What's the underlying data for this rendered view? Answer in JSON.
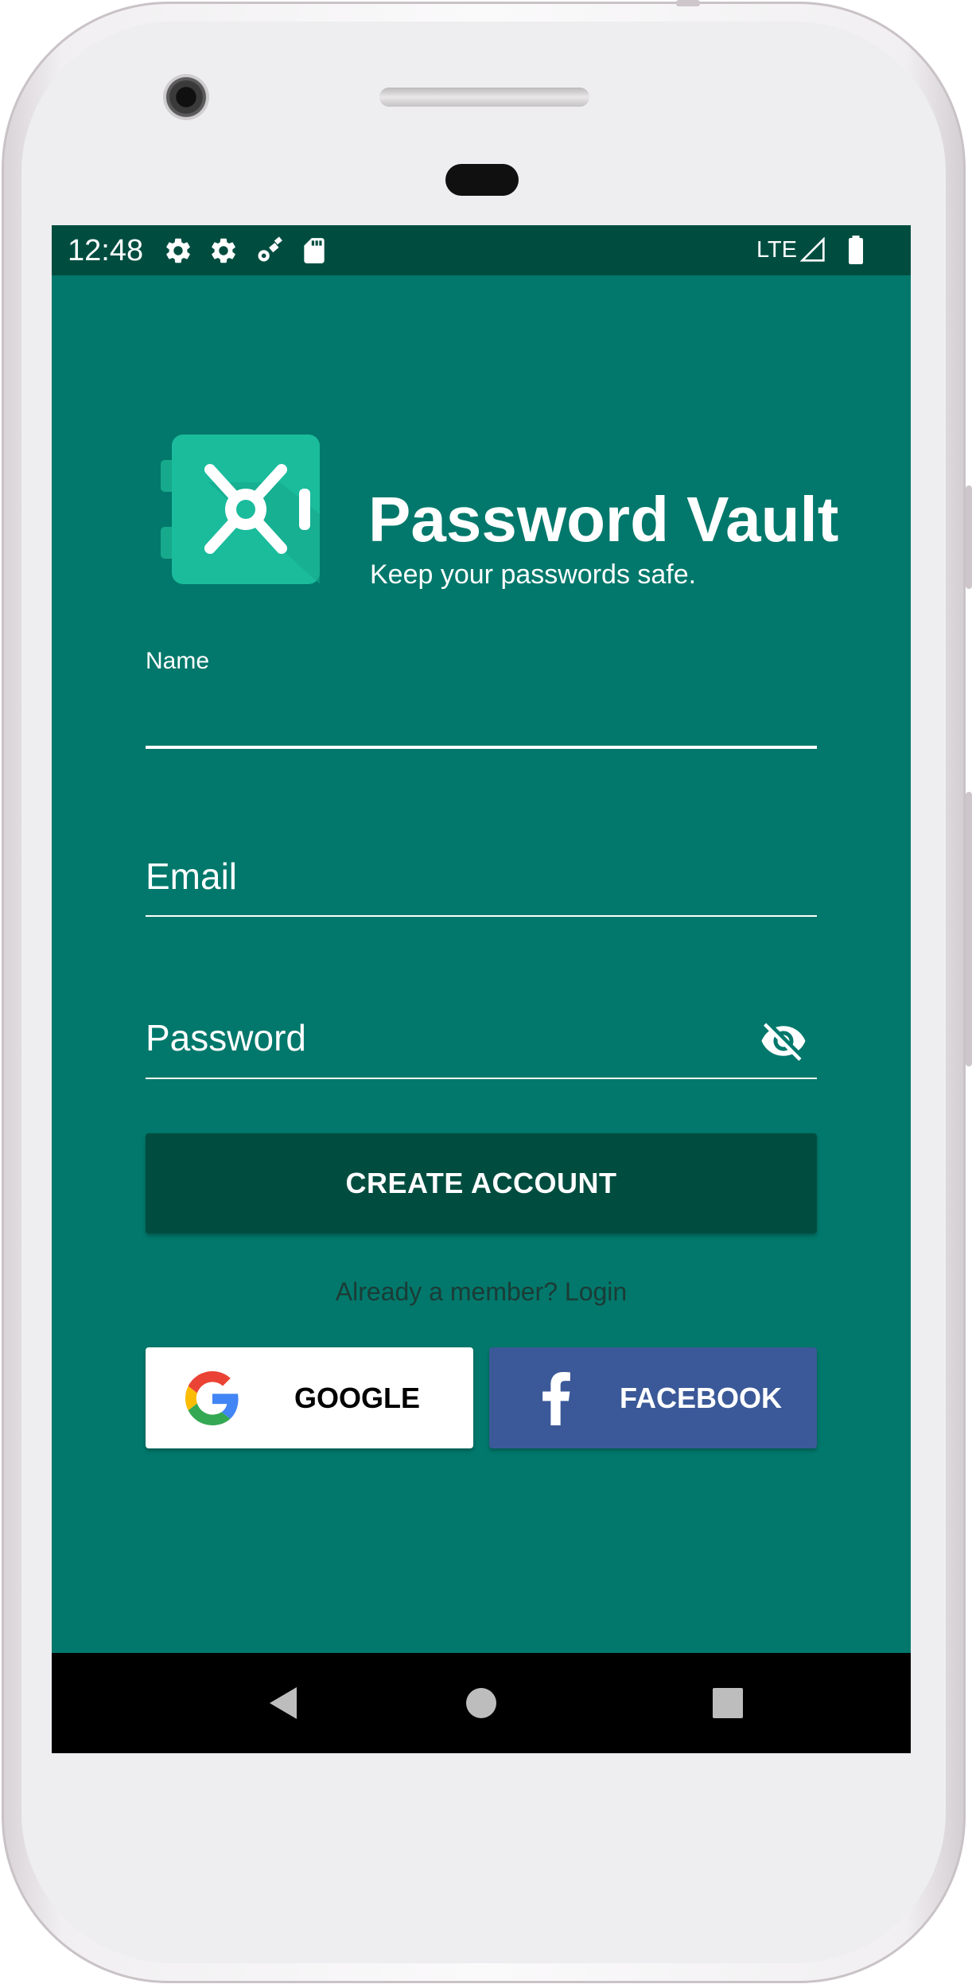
{
  "status_bar": {
    "time": "12:48",
    "notification_icons": [
      "settings-icon",
      "settings-icon",
      "satellite-icon",
      "sd-card-icon"
    ],
    "network_label": "LTE",
    "signal_icon": "signal-icon",
    "battery_icon": "battery-icon"
  },
  "header": {
    "logo_icon": "vault-icon",
    "title": "Password Vault",
    "subtitle": "Keep your passwords safe."
  },
  "form": {
    "name": {
      "label": "Name",
      "value": ""
    },
    "email": {
      "placeholder": "Email",
      "value": ""
    },
    "password": {
      "placeholder": "Password",
      "value": "",
      "toggle_icon": "visibility-off-icon"
    }
  },
  "actions": {
    "create_account_label": "CREATE ACCOUNT",
    "login_prompt": "Already a member? Login"
  },
  "social": {
    "google_label": "GOOGLE",
    "google_icon": "google-icon",
    "facebook_label": "FACEBOOK",
    "facebook_icon": "facebook-icon"
  },
  "nav_bar": {
    "back_icon": "back-icon",
    "home_icon": "home-icon",
    "recents_icon": "recents-icon"
  },
  "colors": {
    "primary": "#01786b",
    "primary_dark": "#004d40",
    "logo_teal": "#1abc9c",
    "facebook_blue": "#3b5998",
    "text_on_primary": "#ffffff",
    "login_text": "#1c3b36",
    "nav_bar": "#000000"
  }
}
